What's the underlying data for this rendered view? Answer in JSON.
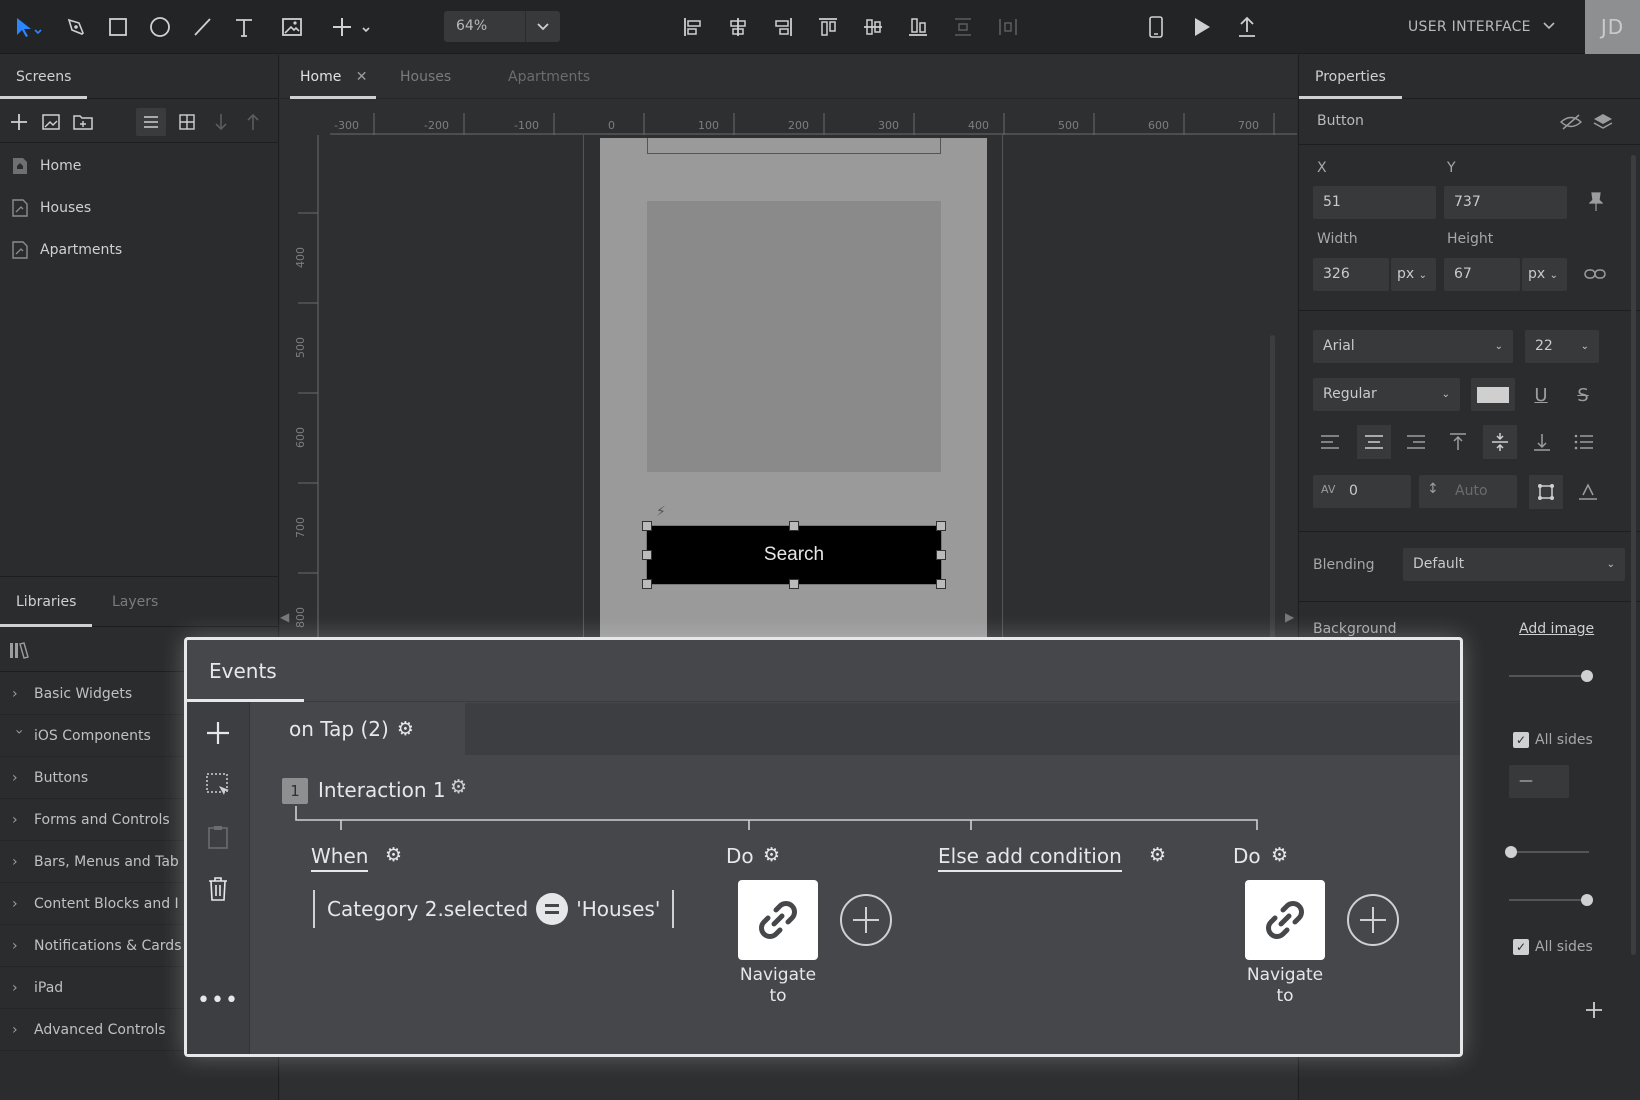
{
  "toolbar": {
    "zoom": "64%",
    "project_menu": "USER INTERFACE",
    "user_initials": "JD",
    "tools": [
      "select-icon",
      "pen-icon",
      "rectangle-icon",
      "ellipse-icon",
      "line-icon",
      "text-icon",
      "image-icon",
      "add-icon"
    ],
    "align_tools": [
      "align-left-icon",
      "align-center-h-icon",
      "align-right-icon",
      "align-top-icon",
      "align-middle-icon",
      "align-bottom-icon",
      "distribute-h-icon",
      "distribute-v-icon"
    ]
  },
  "left": {
    "tabs": {
      "screens": "Screens"
    },
    "screens": [
      "Home",
      "Houses",
      "Apartments"
    ],
    "lib_tabs": {
      "libraries": "Libraries",
      "layers": "Layers"
    },
    "libraries": [
      {
        "label": "Basic Widgets",
        "open": false
      },
      {
        "label": "iOS Components",
        "open": true
      },
      {
        "label": "Buttons",
        "open": false
      },
      {
        "label": "Forms and Controls",
        "open": false
      },
      {
        "label": "Bars, Menus and Tab",
        "open": false
      },
      {
        "label": "Content Blocks and I",
        "open": false
      },
      {
        "label": "Notifications & Cards",
        "open": false
      },
      {
        "label": "iPad",
        "open": false
      },
      {
        "label": "Advanced Controls",
        "open": false
      }
    ]
  },
  "canvas": {
    "tabs": [
      {
        "label": "Home",
        "active": true
      },
      {
        "label": "Houses",
        "active": false
      },
      {
        "label": "Apartments",
        "active": false
      }
    ],
    "ruler_h": [
      "-300",
      "-200",
      "-100",
      "0",
      "100",
      "200",
      "300",
      "400",
      "500",
      "600",
      "700"
    ],
    "ruler_v": [
      "400",
      "500",
      "600",
      "700",
      "800"
    ],
    "button_label": "Search"
  },
  "right": {
    "tab": "Properties",
    "element": "Button",
    "x_label": "X",
    "y_label": "Y",
    "x": "51",
    "y": "737",
    "width_label": "Width",
    "height_label": "Height",
    "width": "326",
    "height": "67",
    "unit": "px",
    "font": "Arial",
    "font_size": "22",
    "font_weight": "Regular",
    "letter_spacing": "0",
    "line_height": "Auto",
    "blending_label": "Blending",
    "blending": "Default",
    "background_label": "Background",
    "add_image": "Add image",
    "all_sides": "All sides",
    "dash": "—"
  },
  "events": {
    "title": "Events",
    "event": "on Tap (2)",
    "interaction_num": "1",
    "interaction": "Interaction 1",
    "when": "When",
    "condition_left": "Category 2.selected",
    "condition_right": "'Houses'",
    "do": "Do",
    "else": "Else add condition",
    "action_line1": "Navigate",
    "action_line2": "to"
  },
  "colors": {
    "accent": "#2b86ff",
    "panel": "#2b2c2e",
    "modal": "#46474a"
  }
}
